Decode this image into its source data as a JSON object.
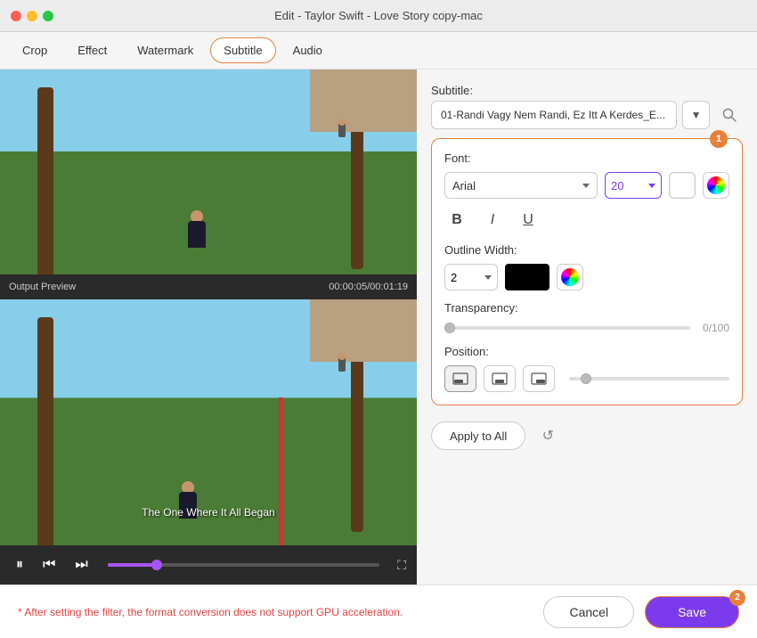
{
  "app": {
    "title": "Edit - Taylor Swift - Love Story copy-mac",
    "traffic_lights": [
      "red",
      "yellow",
      "green"
    ]
  },
  "nav": {
    "tabs": [
      {
        "id": "crop",
        "label": "Crop",
        "active": false
      },
      {
        "id": "effect",
        "label": "Effect",
        "active": false
      },
      {
        "id": "watermark",
        "label": "Watermark",
        "active": false
      },
      {
        "id": "subtitle",
        "label": "Subtitle",
        "active": true
      },
      {
        "id": "audio",
        "label": "Audio",
        "active": false
      }
    ]
  },
  "video": {
    "output_preview_label": "Output Preview",
    "timestamp": "00:00:05/00:01:19",
    "subtitle_text": "The One Where It All Began"
  },
  "subtitle_panel": {
    "label": "Subtitle:",
    "selected_value": "01-Randi Vagy Nem Randi, Ez Itt A Kerdes_E...",
    "badge": "1"
  },
  "font_panel": {
    "font_label": "Font:",
    "selected_font": "Arial",
    "font_size": "20",
    "outline_label": "Outline Width:",
    "outline_width": "2",
    "transparency_label": "Transparency:",
    "transparency_value": "0/100",
    "position_label": "Position:"
  },
  "buttons": {
    "apply_all": "Apply to All",
    "cancel": "Cancel",
    "save": "Save",
    "save_badge": "2"
  },
  "warning": {
    "text": "* After setting the filter, the format conversion does not support GPU acceleration."
  }
}
